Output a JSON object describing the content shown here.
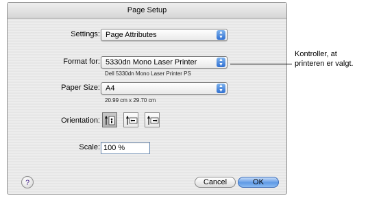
{
  "dialog": {
    "title": "Page Setup",
    "settings": {
      "label": "Settings:",
      "value": "Page Attributes"
    },
    "format_for": {
      "label": "Format for:",
      "value": "5330dn Mono Laser Printer",
      "subtext": "Dell 5330dn Mono Laser Printer PS"
    },
    "paper_size": {
      "label": "Paper Size:",
      "value": "A4",
      "subtext": "20.99 cm x 29.70 cm"
    },
    "orientation": {
      "label": "Orientation:",
      "options": [
        "portrait",
        "landscape-left",
        "landscape-right"
      ],
      "selected": "portrait"
    },
    "scale": {
      "label": "Scale:",
      "value": "100 %"
    },
    "buttons": {
      "help": "?",
      "cancel": "Cancel",
      "ok": "OK"
    }
  },
  "annotation": {
    "line1": "Kontroller, at",
    "line2": "printeren er valgt."
  }
}
